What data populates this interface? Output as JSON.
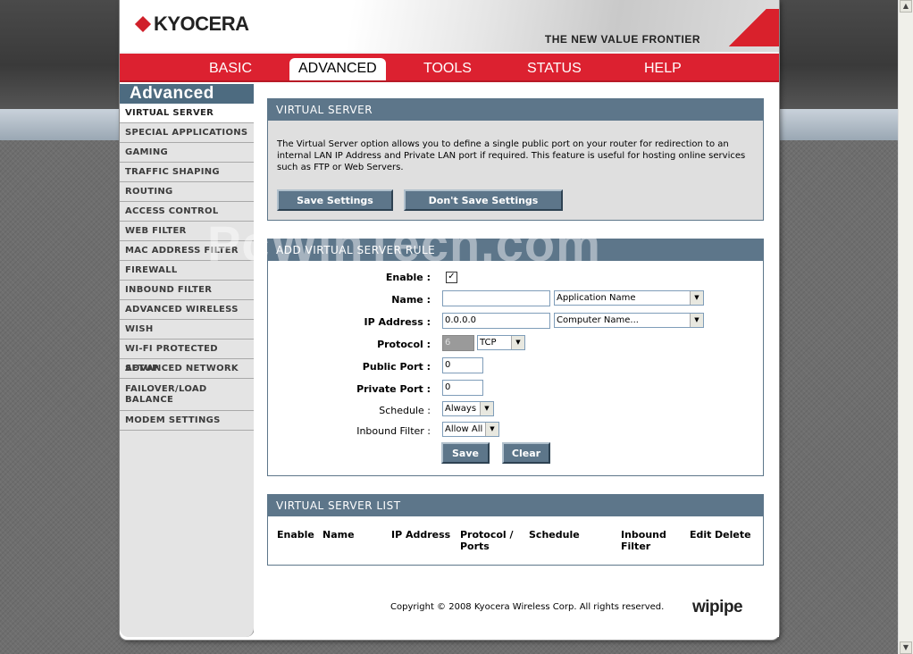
{
  "brand": {
    "logo": "KYOCERA",
    "tagline": "THE NEW VALUE FRONTIER",
    "footer_logo": "wipipe"
  },
  "nav": {
    "tabs": [
      {
        "label": "BASIC"
      },
      {
        "label": "ADVANCED"
      },
      {
        "label": "TOOLS"
      },
      {
        "label": "STATUS"
      },
      {
        "label": "HELP"
      }
    ],
    "active": "ADVANCED"
  },
  "sidebar": {
    "title": "Advanced",
    "items": [
      {
        "label": "VIRTUAL SERVER"
      },
      {
        "label": "SPECIAL APPLICATIONS"
      },
      {
        "label": "GAMING"
      },
      {
        "label": "TRAFFIC SHAPING"
      },
      {
        "label": "ROUTING"
      },
      {
        "label": "ACCESS CONTROL"
      },
      {
        "label": "WEB FILTER"
      },
      {
        "label": "MAC ADDRESS FILTER"
      },
      {
        "label": "FIREWALL"
      },
      {
        "label": "INBOUND FILTER"
      },
      {
        "label": "ADVANCED WIRELESS"
      },
      {
        "label": "WISH"
      },
      {
        "label": "WI-FI PROTECTED SETUP"
      },
      {
        "label": "ADVANCED NETWORK"
      },
      {
        "label": "FAILOVER/LOAD BALANCE"
      },
      {
        "label": "MODEM SETTINGS"
      }
    ]
  },
  "virtual_server": {
    "title": "VIRTUAL SERVER",
    "description": "The Virtual Server option allows you to define a single public port on your router for redirection to an internal LAN IP Address and Private LAN port if required. This feature is useful for hosting online services such as FTP or Web Servers.",
    "save_label": "Save Settings",
    "dont_save_label": "Don't Save Settings"
  },
  "rule": {
    "title": "ADD VIRTUAL SERVER RULE",
    "enable_label": "Enable :",
    "enable_checked": true,
    "name_label": "Name :",
    "name_value": "",
    "app_name_select": "Application Name",
    "ip_label": "IP Address :",
    "ip_value": "0.0.0.0",
    "computer_name_select": "Computer Name...",
    "protocol_label": "Protocol :",
    "protocol_number": "6",
    "protocol_select": "TCP",
    "public_port_label": "Public Port :",
    "public_port_value": "0",
    "private_port_label": "Private Port :",
    "private_port_value": "0",
    "schedule_label": "Schedule :",
    "schedule_select": "Always",
    "inbound_label": "Inbound Filter :",
    "inbound_select": "Allow All",
    "save_label": "Save",
    "clear_label": "Clear"
  },
  "list": {
    "title": "VIRTUAL SERVER LIST",
    "columns": [
      "Enable",
      "Name",
      "IP Address",
      "Protocol / Ports",
      "Schedule",
      "Inbound Filter",
      "Edit",
      "Delete"
    ]
  },
  "footer": {
    "copyright": "Copyright © 2008 Kyocera Wireless Corp. All rights reserved."
  },
  "watermark": "PcWinTech.com",
  "colors": {
    "nav_red": "#dc2130",
    "panel_header": "#5d768a",
    "sidebar_bg": "#e4e4e4"
  }
}
